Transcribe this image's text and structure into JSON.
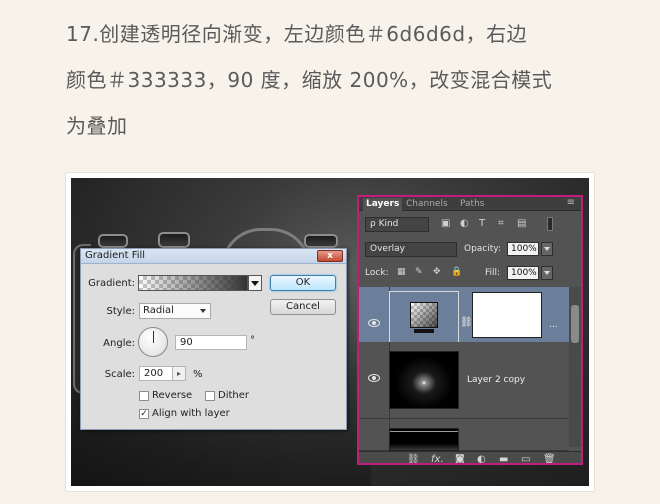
{
  "article": {
    "line1": "17.创建透明径向渐变，左边颜色＃6d6d6d，右边",
    "line2": "颜色＃333333，90 度，缩放 200%，改变混合模式",
    "line3": "为叠加"
  },
  "gradient_dialog": {
    "title": "Gradient Fill",
    "close": "x",
    "gradient_label": "Gradient:",
    "gradient_colors": {
      "left": "#6d6d6d",
      "right": "#333333"
    },
    "style_label": "Style:",
    "style_value": "Radial",
    "angle_label": "Angle:",
    "angle_value": "90",
    "angle_unit": "°",
    "scale_label": "Scale:",
    "scale_value": "200",
    "scale_unit": "%",
    "scale_stepper": "▸",
    "reverse_label": "Reverse",
    "reverse_checked": false,
    "dither_label": "Dither",
    "dither_checked": false,
    "align_label": "Align with layer",
    "align_checked": true,
    "align_check_mark": "✓",
    "ok": "OK",
    "cancel": "Cancel"
  },
  "layers_panel": {
    "tabs": [
      "Layers",
      "Channels",
      "Paths"
    ],
    "menu_icon": "≡",
    "filter_value": "ρ Kind",
    "filter_icons": [
      "image-filter-icon",
      "adjustment-filter-icon",
      "type-filter-icon",
      "shape-filter-icon",
      "smart-object-filter-icon"
    ],
    "filter_glyphs": [
      "▣",
      "◐",
      "T",
      "⌗",
      "▤"
    ],
    "blend_mode": "Overlay",
    "opacity_label": "Opacity:",
    "opacity_value": "100%",
    "lock_label": "Lock:",
    "lock_glyphs": [
      "▦",
      "✎",
      "✥",
      "🔒"
    ],
    "fill_label": "Fill:",
    "fill_value": "100%",
    "layers": [
      {
        "name": "",
        "selected": true,
        "type": "gradient-fill-layer"
      },
      {
        "name": "Layer 2 copy",
        "selected": false
      },
      {
        "name": "",
        "selected": false
      }
    ],
    "layer1_ellipsis": "...",
    "link_glyph": "⛓",
    "bottom_glyphs": [
      "⛓",
      "fx.",
      "◙",
      "◐",
      "▬",
      "▭",
      "🗑"
    ]
  }
}
